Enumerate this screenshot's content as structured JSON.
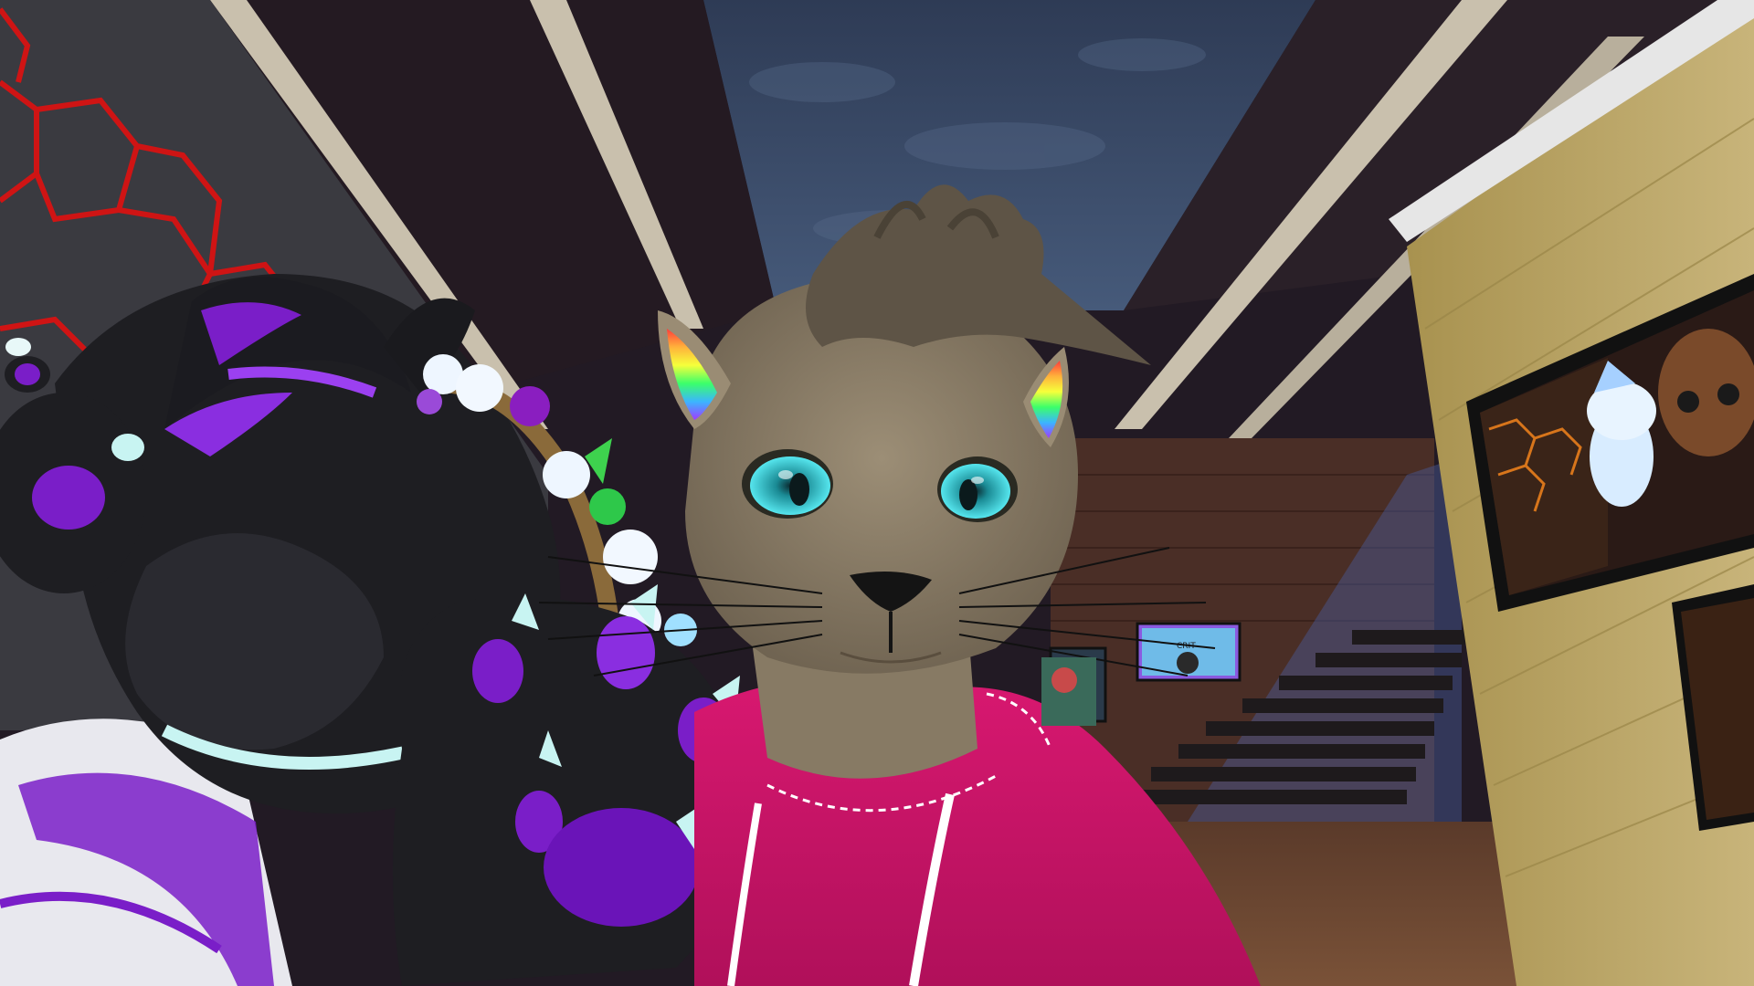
{
  "scene": {
    "type": "VR social world screenshot",
    "palette": {
      "ceiling_sky": "#3a4a66",
      "beam": "#c9c0ad",
      "hex_wall": "#3a3a40",
      "hex_glow": "#e01010",
      "brick_wall": "#4a2e26",
      "wood_panel": "#b8a46a",
      "floor": "#6e4a34",
      "cat_fur": "#8c7e68",
      "cat_eyes": "#3fd4dc",
      "hoodie": "#e01a78",
      "paw_black": "#1e1e22",
      "paw_pad": "#7a1ec8",
      "flowers": "#eef6ff",
      "rainbow_ear": [
        "#ff3b3b",
        "#ffb13b",
        "#f6ff3b",
        "#3bff6a",
        "#3bb5ff",
        "#a03bff"
      ]
    },
    "screens": {
      "small_screen_text": "",
      "small_screen_badge_text": "CRIT"
    }
  }
}
